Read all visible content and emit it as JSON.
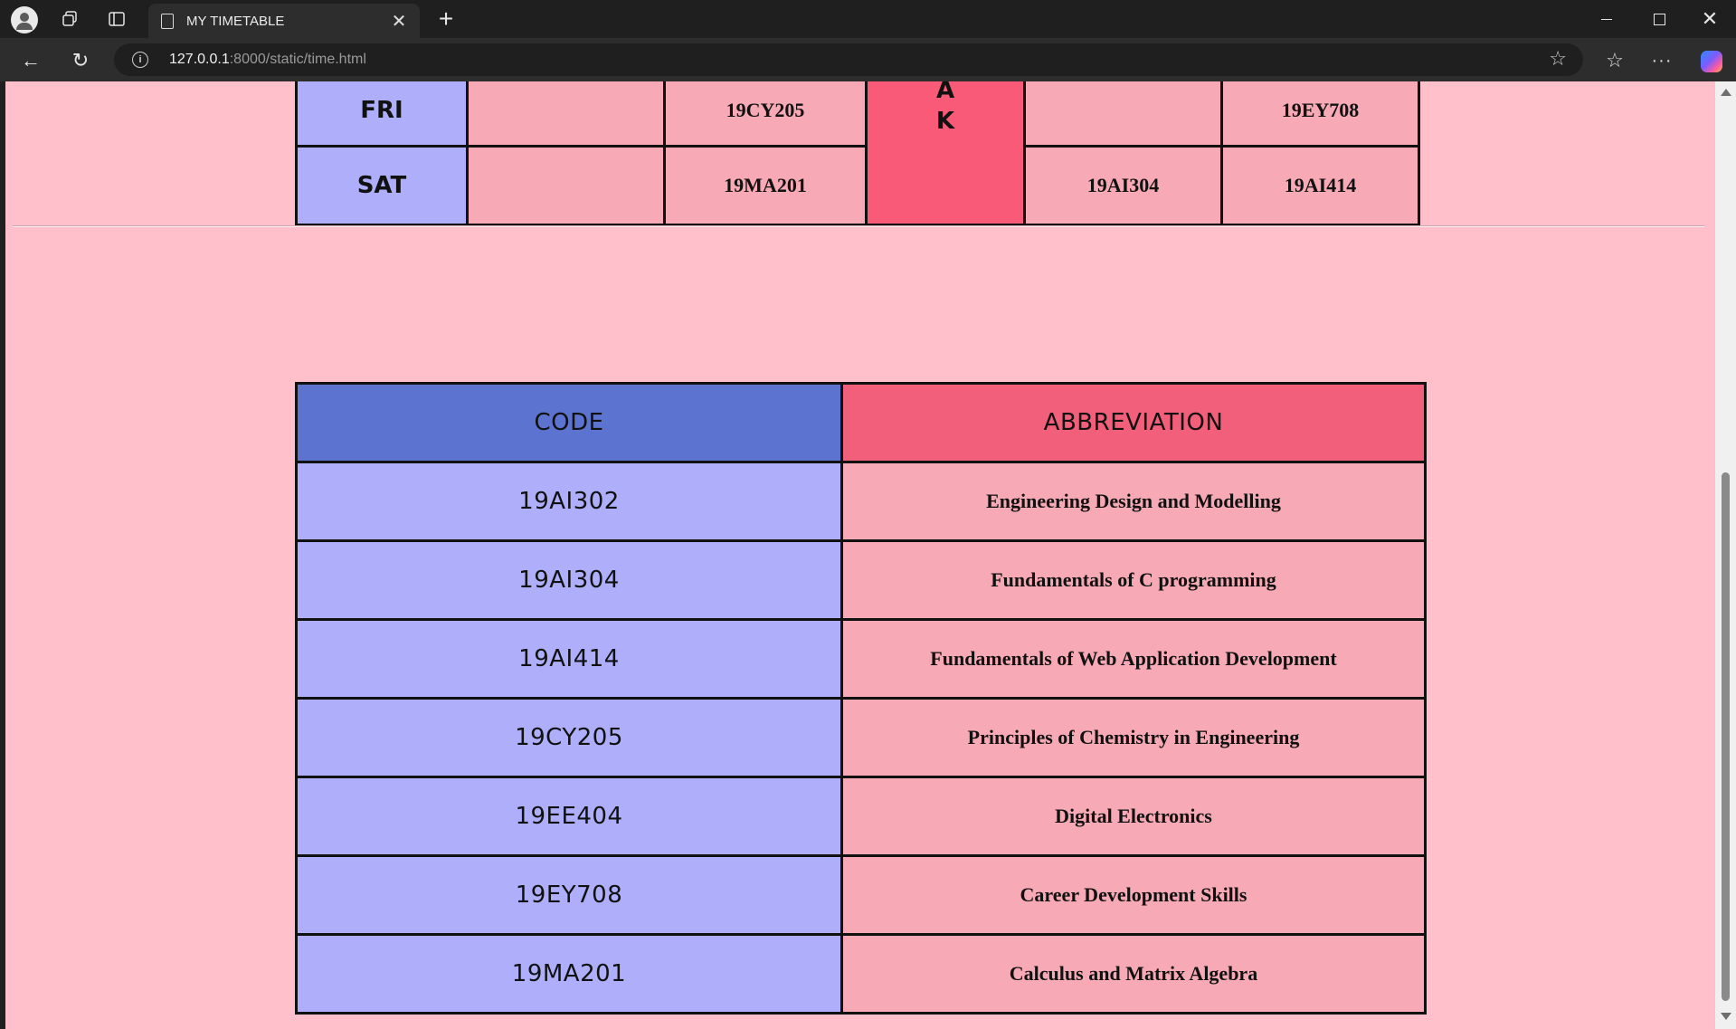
{
  "browser": {
    "tab_title": "MY TIMETABLE",
    "url_host": "127.0.0.1",
    "url_rest": ":8000/static/time.html",
    "icons": {
      "profile": "profile-icon",
      "workspaces": "workspaces-icon",
      "tab_actions": "tab-actions-icon",
      "tab_page": "page-icon",
      "close_tab": "close-icon",
      "new_tab": "plus-icon",
      "back": "back-arrow-icon",
      "reload": "reload-icon",
      "site_info": "info-icon",
      "favorite": "star-icon",
      "favorites": "favorites-icon",
      "menu": "more-icon",
      "copilot": "copilot-icon"
    }
  },
  "timetable": {
    "rows": [
      {
        "day": "FRI",
        "p1": "",
        "p2": "19CY205",
        "p3": "",
        "p4": "19EY708"
      },
      {
        "day": "SAT",
        "p1": "",
        "p2": "19MA201",
        "p3": "19AI304",
        "p4": "19AI414"
      }
    ],
    "break_letters": [
      "A",
      "K"
    ]
  },
  "codes_table": {
    "headers": {
      "code": "CODE",
      "abbreviation": "ABBREVIATION"
    },
    "rows": [
      {
        "code": "19AI302",
        "name": "Engineering Design and Modelling"
      },
      {
        "code": "19AI304",
        "name": "Fundamentals of C programming"
      },
      {
        "code": "19AI414",
        "name": "Fundamentals of Web Application Development"
      },
      {
        "code": "19CY205",
        "name": "Principles of Chemistry in Engineering"
      },
      {
        "code": "19EE404",
        "name": "Digital Electronics"
      },
      {
        "code": "19EY708",
        "name": "Career Development Skills"
      },
      {
        "code": "19MA201",
        "name": "Calculus and Matrix Algebra"
      }
    ]
  },
  "colors": {
    "page_bg": "#ffbfcb",
    "day_cell": "#aeaefb",
    "subject_cell": "#f7a9b5",
    "break_cell": "#f95a78",
    "code_header": "#5c74cf",
    "abbr_header": "#f15f7a"
  }
}
